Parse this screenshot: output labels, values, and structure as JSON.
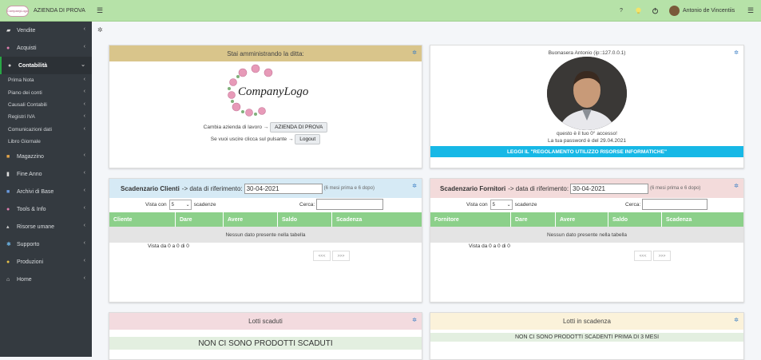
{
  "brand": {
    "logo_text": "CompanyLogo",
    "name": "AZIENDA DI PROVA"
  },
  "topbar": {
    "help": "?",
    "user_name": "Antonio de Vincentiis"
  },
  "sidebar": {
    "items_top": [
      {
        "label": "Vendite",
        "icon": "truck-icon"
      },
      {
        "label": "Acquisti",
        "icon": "cart-icon"
      },
      {
        "label": "Contabilità",
        "icon": "coins-icon",
        "active": true
      }
    ],
    "sub_items": [
      {
        "label": "Prima Nota"
      },
      {
        "label": "Piano dei conti"
      },
      {
        "label": "Causali Contabili"
      },
      {
        "label": "Registri IVA"
      },
      {
        "label": "Comunicazioni dati"
      },
      {
        "label": "Libro Giornale"
      }
    ],
    "items_bottom": [
      {
        "label": "Magazzino",
        "icon": "box-icon"
      },
      {
        "label": "Fine Anno",
        "icon": "file-icon"
      },
      {
        "label": "Archivi di Base",
        "icon": "archive-icon"
      },
      {
        "label": "Tools & Info",
        "icon": "tools-icon"
      },
      {
        "label": "Risorse umane",
        "icon": "users-icon"
      },
      {
        "label": "Supporto",
        "icon": "support-icon"
      },
      {
        "label": "Produzioni",
        "icon": "gear-icon"
      },
      {
        "label": "Home",
        "icon": "home-icon"
      }
    ]
  },
  "ditta": {
    "title": "Stai amministrando la ditta:",
    "logo": "CompanyLogo",
    "change_label": "Cambia azienda di lavoro →",
    "company_button": "AZIENDA DI PROVA",
    "exit_label": "Se vuoi uscire clicca sul pulsante →",
    "logout_button": "Logout"
  },
  "welcome": {
    "greeting": "Buonasera Antonio (ip::127.0.0.1)",
    "access": "questo è il tuo 0° accesso!",
    "password": "La tua password è del 29.04.2021",
    "rules_button": "LEGGI IL \"REGOLAMENTO UTILIZZO RISORSE INFORMATICHE\""
  },
  "clienti": {
    "title_strong": "Scadenzario Clienti",
    "title_rest": "-> data di riferimento:",
    "date": "30-04-2021",
    "note": "(6 mesi prima e 6 dopo)",
    "show": "Vista con",
    "show_val": "5",
    "show_after": "scadenze",
    "search": "Cerca:",
    "columns": [
      "Cliente",
      "Dare",
      "Avere",
      "Saldo",
      "Scadenza"
    ],
    "empty": "Nessun dato presente nella tabella",
    "info": "Vista da 0 a 0 di 0",
    "prev": "<<<",
    "next": ">>>"
  },
  "fornitori": {
    "title_strong": "Scadenzario Fornitori",
    "title_rest": "-> data di riferimento:",
    "date": "30-04-2021",
    "note": "(6 mesi prima e 6 dopo)",
    "show": "Vista con",
    "show_val": "5",
    "show_after": "scadenze",
    "search": "Cerca:",
    "columns": [
      "Fornitore",
      "Dare",
      "Avere",
      "Saldo",
      "Scadenza"
    ],
    "empty": "Nessun dato presente nella tabella",
    "info": "Vista da 0 a 0 di 0",
    "prev": "<<<",
    "next": ">>>"
  },
  "lotti_scaduti": {
    "title": "Lotti scaduti",
    "message": "NON CI SONO PRODOTTI SCADUTI"
  },
  "lotti_scadenza": {
    "title": "Lotti in scadenza",
    "message": "NON CI SONO PRODOTTI SCADENTI PRIMA DI 3 MESI"
  },
  "colors": {
    "topbar": "#b6e2a8",
    "sidebar": "#343a40",
    "table_head": "#8cd08a",
    "rules_button": "#17b8e6"
  }
}
